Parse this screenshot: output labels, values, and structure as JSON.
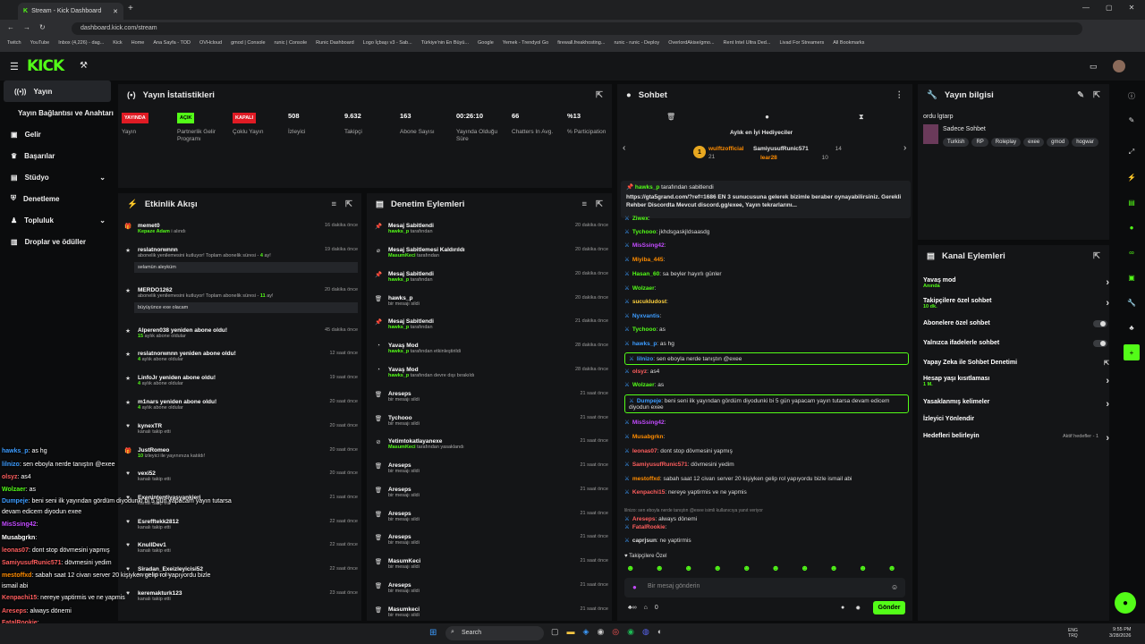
{
  "browser": {
    "tab_title": "Stream - Kick Dashboard",
    "url": "dashboard.kick.com/stream",
    "bookmarks": [
      "Twitch",
      "YouTube",
      "Inbox (4,226) - dag...",
      "Kick",
      "Home",
      "Ana Sayfa - TOD",
      "OVHcloud",
      "gmod | Console",
      "runic | Console",
      "Runic Dashboard",
      "Logo İçbaşı v3 - Sab...",
      "Türkiye'nin En Büyü...",
      "Google",
      "Yemek - Trendyol Go",
      "firewall.freakhosting...",
      "runic - runic - Deploy",
      "OverlordAkise/gmo...",
      "Rent Intel Ultra Ded...",
      "Livad For Streamers",
      "All Bookmarks"
    ]
  },
  "sidebar": {
    "items": [
      "Yayın",
      "Yayın Bağlantısı ve Anahtarı",
      "Gelir",
      "Başarılar",
      "Stüdyo",
      "Denetleme",
      "Topluluk",
      "Droplar ve ödüller"
    ]
  },
  "stats": {
    "title": "Yayın İstatistikleri",
    "cols": [
      {
        "badge": "YAYINDA",
        "badge_color": "#e01b24",
        "label": "Yayın"
      },
      {
        "badge": "AÇIK",
        "badge_color": "#53fc18",
        "label": "Partnerlik Gelir Programı"
      },
      {
        "badge": "KAPALI",
        "badge_color": "#e01b24",
        "label": "Çoklu Yayın"
      },
      {
        "value": "508",
        "label": "İzleyici"
      },
      {
        "value": "9.632",
        "label": "Takipçi"
      },
      {
        "value": "163",
        "label": "Abone Sayısı"
      },
      {
        "value": "00:26:10",
        "label": "Yayında Olduğu Süre"
      },
      {
        "value": "66",
        "label": "Chatters In Avg."
      },
      {
        "value": "%13",
        "label": "% Participation"
      }
    ]
  },
  "activity": {
    "title": "Etkinlik Akışı",
    "rows": [
      {
        "icon": "gift-icon",
        "name": "memet0",
        "sub": "Kepaze Adam",
        "sub2": " i alındı",
        "time": "16 dakika önce"
      },
      {
        "icon": "star-icon",
        "name": "reslatnorwnnn",
        "sub": "abonelik yenilemesini kutluyor! Toplam abonelik süresi - ",
        "subg": "4",
        "sub3": " ay!",
        "msg": "selamün aleyküm",
        "time": "19 dakika önce"
      },
      {
        "icon": "star-icon",
        "name": "MERDO1262",
        "sub": "abonelik yenilemesini kutluyor! Toplam abonelik süresi - ",
        "subg": "11",
        "sub3": " ay!",
        "msg": "büyüyünce exe olacam",
        "time": "20 dakika önce"
      },
      {
        "icon": "star-icon",
        "name": "Alperen038 yeniden abone oldu!",
        "subg": "15",
        "sub3": " aylık abone oldular",
        "time": "45 dakika önce"
      },
      {
        "icon": "star-icon",
        "name": "reslatnorwnnn yeniden abone oldu!",
        "subg": "4",
        "sub3": " aylık abone oldular",
        "time": "12 saat önce"
      },
      {
        "icon": "star-icon",
        "name": "LinfoJr yeniden abone oldu!",
        "subg": "4",
        "sub3": " aylık abone oldular",
        "time": "19 saat önce"
      },
      {
        "icon": "star-icon",
        "name": "m1nars yeniden abone oldu!",
        "subg": "4",
        "sub3": " aylık abone oldular",
        "time": "20 saat önce"
      },
      {
        "icon": "heart-icon",
        "name": "kynexTR",
        "sub": "kanalı takip etti",
        "time": "20 saat önce"
      },
      {
        "icon": "gift-icon",
        "name": "JustRomeo",
        "subg": "10",
        "sub3": " izleyici ile yayınınıza katıldı!",
        "time": "20 saat önce"
      },
      {
        "icon": "heart-icon",
        "name": "vexi52",
        "sub": "kanalı takip etti",
        "time": "20 saat önce"
      },
      {
        "icon": "heart-icon",
        "name": "Exenintentiyasyankieri",
        "sub": "kanalı takip etti",
        "time": "21 saat önce"
      },
      {
        "icon": "heart-icon",
        "name": "Esrefftekk2812",
        "sub": "kanalı takip etti",
        "time": "22 saat önce"
      },
      {
        "icon": "heart-icon",
        "name": "KnullDev1",
        "sub": "kanalı takip etti",
        "time": "22 saat önce"
      },
      {
        "icon": "heart-icon",
        "name": "Siradan_Exeizleyicisi52",
        "sub": "kanalı takip etti",
        "time": "22 saat önce"
      },
      {
        "icon": "heart-icon",
        "name": "keremakturk123",
        "sub": "kanalı takip etti",
        "time": "23 saat önce"
      }
    ]
  },
  "moderation": {
    "title": "Denetim Eylemleri",
    "rows": [
      {
        "icon": "pin-icon",
        "name": "Mesaj Sabitlendi",
        "user": "hawks_p",
        "sub": " tarafından",
        "time": "20 dakika önce"
      },
      {
        "icon": "unpin-icon",
        "name": "Mesaj Sabitlemesi Kaldırıldı",
        "user": "MasumKeci",
        "sub": " tarafından",
        "time": "20 dakika önce"
      },
      {
        "icon": "pin-icon",
        "name": "Mesaj Sabitlendi",
        "user": "hawks_p",
        "sub": " tarafından",
        "time": "20 dakika önce"
      },
      {
        "icon": "trash-icon",
        "name": "hawks_p",
        "sub": "bir mesajı sildi",
        "time": "20 dakika önce"
      },
      {
        "icon": "pin-icon",
        "name": "Mesaj Sabitlendi",
        "user": "hawks_p",
        "sub": " tarafından",
        "time": "21 dakika önce"
      },
      {
        "icon": "slow-icon",
        "name": "Yavaş Mod",
        "sub": "",
        "user": "hawks_p",
        "sub2": " tarafından etkinleştirildi",
        "time": "28 dakika önce"
      },
      {
        "icon": "slow-icon",
        "name": "Yavaş Mod",
        "user": "hawks_p",
        "sub": " tarafından devre dışı bırakıldı",
        "time": "28 dakika önce"
      },
      {
        "icon": "trash-icon",
        "name": "Areseps",
        "sub": "bir mesajı sildi",
        "time": "21 saat önce"
      },
      {
        "icon": "trash-icon",
        "name": "Tychooo",
        "sub": "bir mesajı sildi",
        "time": "21 saat önce"
      },
      {
        "icon": "ban-icon",
        "name": "Yetimtokatlayanexe",
        "user": "MasumKeci",
        "sub": " tarafından yasaklandı",
        "time": "21 saat önce"
      },
      {
        "icon": "trash-icon",
        "name": "Areseps",
        "sub": "bir mesajı sildi",
        "time": "21 saat önce"
      },
      {
        "icon": "trash-icon",
        "name": "Areseps",
        "sub": "bir mesajı sildi",
        "time": "21 saat önce"
      },
      {
        "icon": "trash-icon",
        "name": "Areseps",
        "sub": "bir mesajı sildi",
        "time": "21 saat önce"
      },
      {
        "icon": "trash-icon",
        "name": "Areseps",
        "sub": "bir mesajı sildi",
        "time": "21 saat önce"
      },
      {
        "icon": "trash-icon",
        "name": "MasumKeci",
        "sub": "bir mesajı sildi",
        "time": "21 saat önce"
      },
      {
        "icon": "trash-icon",
        "name": "Areseps",
        "sub": "bir mesajı sildi",
        "time": "21 saat önce"
      },
      {
        "icon": "trash-icon",
        "name": "Masumkeci",
        "sub": "bir mesajı sildi",
        "time": "21 saat önce"
      }
    ]
  },
  "chat": {
    "title": "Sohbet",
    "gifter_title": "Aylık en İyi Hediyeciler",
    "gifters": [
      {
        "name": "wulftzofficial",
        "count": "21"
      },
      {
        "name": "SamiyusufRunic571",
        "count": "14"
      },
      {
        "name": "lear28",
        "count": "10"
      }
    ],
    "pinned_user": "hawks_p",
    "pinned_by": " tarafından sabitlendi",
    "pinned_msg": "https://gta5grand.com/?ref=1686 EN 3 sunucusuna gelerek bizimle beraber oynayabilirsiniz. Gerekli Rehber Discordta Mevcut discord.gg/exee, Yayın tekrarlarını...",
    "lines": [
      {
        "u": "Ziwex",
        "c": "#53fc18",
        "m": ":"
      },
      {
        "u": "Tychooo",
        "c": "#53fc18",
        "m": ": jkhdsgaskjldsaasdg"
      },
      {
        "u": "MisSsing42",
        "c": "#c34bff",
        "m": ":"
      },
      {
        "u": "Miyiba_445",
        "c": "#ff8c00",
        "m": ":"
      },
      {
        "u": "Hasan_60",
        "c": "#53fc18",
        "m": ": sa beyler hayırlı günler"
      },
      {
        "u": "Wolzaer",
        "c": "#53fc18",
        "m": ":"
      },
      {
        "u": "sucukludost",
        "c": "#ffd23f",
        "m": ":"
      },
      {
        "u": "Nyxvantis",
        "c": "#3c9cff",
        "m": ":"
      },
      {
        "u": "Tychooo",
        "c": "#53fc18",
        "m": ": as"
      },
      {
        "u": "hawks_p",
        "c": "#3c9cff",
        "m": ": as hg"
      },
      {
        "u": "lilnizo",
        "c": "#3c9cff",
        "m": ": sen eboyla nerde tanıştın @exee",
        "hl": true
      },
      {
        "u": "olsyz",
        "c": "#ff5e5e",
        "m": ": as4"
      },
      {
        "u": "Wolzaer",
        "c": "#53fc18",
        "m": ": as"
      },
      {
        "u": "Dumpeje",
        "c": "#3c9cff",
        "m": ": beni seni ilk yayından gördüm diyodunki bi 5 gün yapacam yayın tutarsa devam edicem diyodun exee",
        "hl": true
      },
      {
        "u": "MisSsing42",
        "c": "#c34bff",
        "m": ":"
      },
      {
        "u": "Musabgrkn",
        "c": "#ff8c00",
        "m": ":"
      },
      {
        "u": "leonas07",
        "c": "#ff5e5e",
        "m": ": dont stop dövmesini yapmış"
      },
      {
        "u": "SamiyusufRunic571",
        "c": "#ff5e5e",
        "m": ": dövmesini yedim"
      },
      {
        "u": "mestoffxd",
        "c": "#ff8c00",
        "m": ": sabah saat 12 civarı server 20 kişiyken gelip rol yapıyordu bizle ismail abi"
      },
      {
        "u": "Kenpachi15",
        "c": "#ff5e5e",
        "m": ": nereye yaptirmis ve ne yapmis"
      },
      {
        "u": "Areseps",
        "c": "#ff5e5e",
        "m": ": always dönemi",
        "reply": "lilnizo: sen eboyla nerde tanıştın @exee isimli kullanıcıya yanıt veriyor"
      },
      {
        "u": "FatalRookie",
        "c": "#ff5e5e",
        "m": ":"
      },
      {
        "u": "caprjsun",
        "c": "#ddd",
        "m": ": ne yaptirmis"
      }
    ],
    "followers_only": "Takipçilere Özel",
    "input_placeholder": "Bir mesaj gönderin",
    "send": "Gönder",
    "count": "0"
  },
  "overlay_chat": [
    {
      "u": "hawks_p",
      "c": "#3c9cff",
      "m": ": as hg"
    },
    {
      "u": "lilnizo",
      "c": "#3c9cff",
      "m": ": sen eboyla nerde tanıştın @exee"
    },
    {
      "u": "olsyz",
      "c": "#ff5e5e",
      "m": ": as4"
    },
    {
      "u": "Wolzaer",
      "c": "#53fc18",
      "m": ": as"
    },
    {
      "u": "Dumpeje",
      "c": "#3c9cff",
      "m": ": beni seni ilk yayından gördüm diyodunki bi 5 gün yapacam yayın tutarsa"
    },
    {
      "u": "",
      "c": "#fff",
      "m": "devam edicem diyodun exee"
    },
    {
      "u": "MisSsing42",
      "c": "#c34bff",
      "m": ":"
    },
    {
      "u": "Musabgrkn",
      "c": "#fff",
      "m": ":"
    },
    {
      "u": "leonas07",
      "c": "#ff5e5e",
      "m": ": dont stop dövmesini yapmış"
    },
    {
      "u": "SamiyusufRunic571",
      "c": "#ff5e5e",
      "m": ": dövmesini yedim"
    },
    {
      "u": "mestoffxd",
      "c": "#ff8c00",
      "m": ": sabah saat 12 civarı server 20 kişiyken gelip rol yapıyordu bizle"
    },
    {
      "u": "",
      "c": "#fff",
      "m": "ismail abi"
    },
    {
      "u": "Kenpachi15",
      "c": "#ff5e5e",
      "m": ": nereye yaptirmis ve ne yapmis"
    },
    {
      "u": "Areseps",
      "c": "#ff5e5e",
      "m": ": always dönemi"
    },
    {
      "u": "FatalRookie",
      "c": "#ff5e5e",
      "m": ":"
    },
    {
      "u": "caprjsun",
      "c": "#fff",
      "m": ": ne yaptirmis"
    }
  ],
  "stream_info": {
    "title": "Yayın bilgisi",
    "stream_title": "ordu lgtarp",
    "category": "Sadece Sohbet",
    "tags": [
      "Turkish",
      "RP",
      "Roleplay",
      "exee",
      "gmod",
      "hogwar"
    ]
  },
  "channel_actions": {
    "title": "Kanal Eylemleri",
    "rows": [
      {
        "label": "Yavaş mod",
        "sub": "Anında",
        "type": "arrow"
      },
      {
        "label": "Takipçilere özel sohbet",
        "sub": "10 dk.",
        "type": "arrow"
      },
      {
        "label": "Abonelere özel sohbet",
        "type": "toggle"
      },
      {
        "label": "Yalnızca ifadelerle sohbet",
        "type": "toggle"
      },
      {
        "label": "Yapay Zeka ile Sohbet Denetimi",
        "type": "link"
      },
      {
        "label": "Hesap yaşı kısıtlaması",
        "sub": "1 M.",
        "type": "arrow"
      },
      {
        "label": "Yasaklanmış kelimeler",
        "type": "arrow"
      },
      {
        "label": "İzleyici Yönlendir",
        "type": "none"
      },
      {
        "label": "Hedefleri belirleyin",
        "extra": "Aktif hedefler - 1",
        "type": "arrow"
      }
    ]
  },
  "taskbar": {
    "search": "Search",
    "lang": "ENG",
    "lang2": "TRQ",
    "time": "9:55 PM",
    "date": "3/28/2026"
  }
}
